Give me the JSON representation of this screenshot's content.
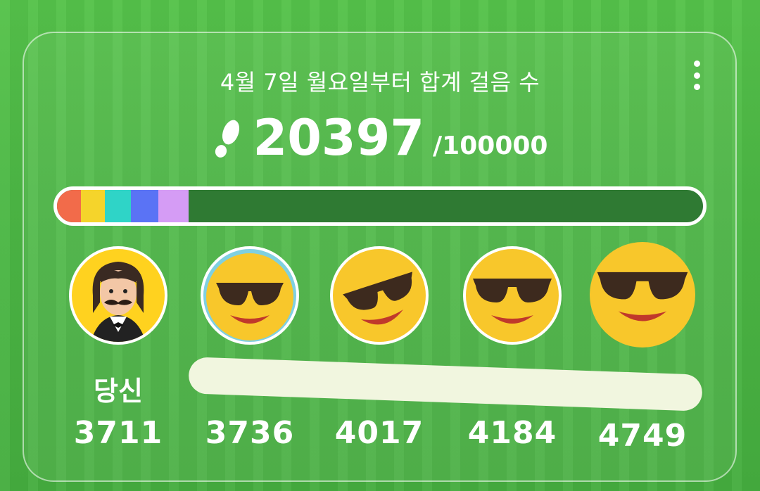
{
  "header": {
    "subtitle": "4월 7일 월요일부터 합계 걸음 수",
    "steps_total": "20397",
    "steps_goal": "/100000",
    "progress_fraction": 0.204
  },
  "icons": {
    "steps": "footprints-icon",
    "menu": "more-vertical-icon"
  },
  "progress_segments": [
    {
      "color": "#f26b4a",
      "value": 3711
    },
    {
      "color": "#f5d42b",
      "value": 3736
    },
    {
      "color": "#2fd4c7",
      "value": 4017
    },
    {
      "color": "#5a73f5",
      "value": 4184
    },
    {
      "color": "#d59cf5",
      "value": 4749
    }
  ],
  "members": [
    {
      "name": "당신",
      "steps": "3711",
      "avatar": "avatar-mustache-man"
    },
    {
      "name": "",
      "steps": "3736",
      "avatar": "emoji-sunglasses"
    },
    {
      "name": "",
      "steps": "4017",
      "avatar": "emoji-sunglasses"
    },
    {
      "name": "",
      "steps": "4184",
      "avatar": "emoji-sunglasses"
    },
    {
      "name": "",
      "steps": "4749",
      "avatar": "emoji-sunglasses"
    }
  ]
}
